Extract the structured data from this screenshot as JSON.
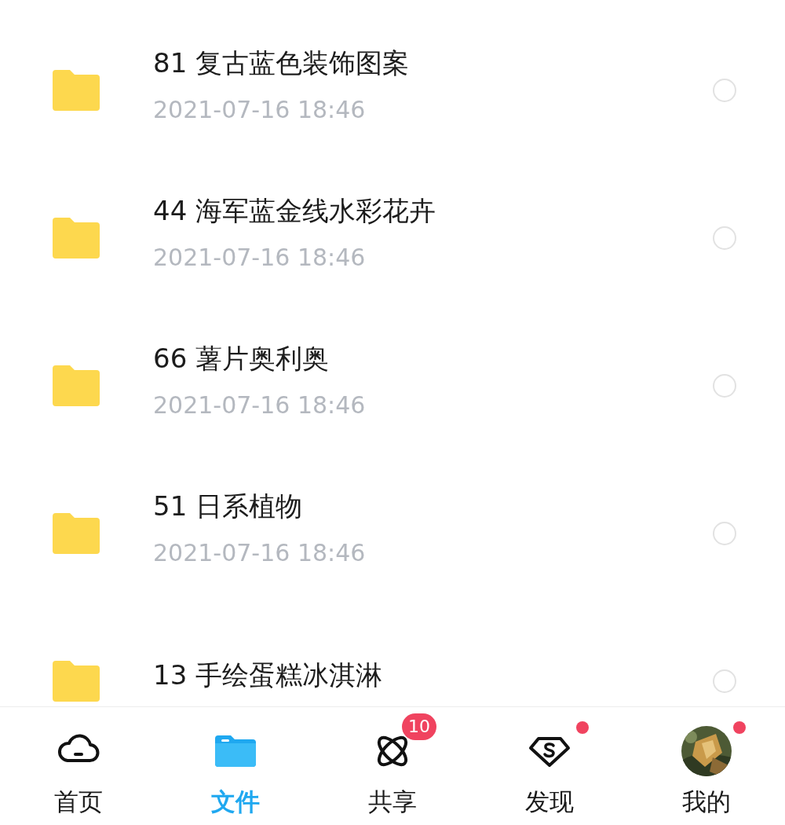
{
  "files": [
    {
      "name": "81 复古蓝色装饰图案",
      "date": "2021-07-16  18:46",
      "selected": false
    },
    {
      "name": "44 海军蓝金线水彩花卉",
      "date": "2021-07-16  18:46",
      "selected": false
    },
    {
      "name": "66 薯片奥利奥",
      "date": "2021-07-16  18:46",
      "selected": false
    },
    {
      "name": "51 日系植物",
      "date": "2021-07-16  18:46",
      "selected": false
    },
    {
      "name": "13  手绘蛋糕冰淇淋",
      "selected": false
    }
  ],
  "tab_bar": [
    {
      "kind": "cloud",
      "label": "首页",
      "selected": false,
      "dot": false
    },
    {
      "kind": "folder",
      "label": "文件",
      "selected": true,
      "dot": false
    },
    {
      "kind": "orbit",
      "label": "共享",
      "selected": false,
      "badge": "10",
      "dot": false
    },
    {
      "kind": "gem",
      "label": "发现",
      "selected": false,
      "dot": true
    },
    {
      "kind": "avatar",
      "label": "我的",
      "selected": false,
      "dot": true
    }
  ]
}
